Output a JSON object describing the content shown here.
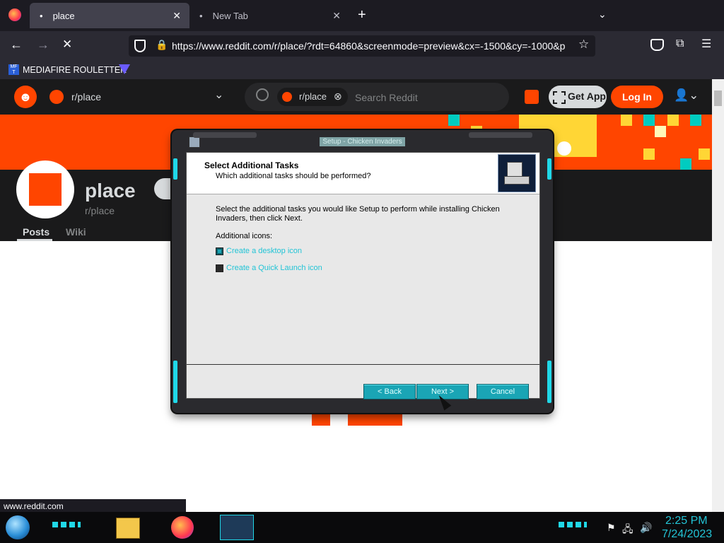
{
  "browser": {
    "tabs": [
      {
        "label": "place",
        "active": true
      },
      {
        "label": "New Tab",
        "active": false
      }
    ],
    "url": "https://www.reddit.com/r/place/?rdt=64860&screenmode=preview&cx=-1500&cy=-1000&p",
    "bookmarks": [
      {
        "label": "MEDIAFIRE ROULETTER",
        "icon": "mf-icon"
      },
      {
        "label": "",
        "icon": "triangle-icon"
      }
    ],
    "status_url": "www.reddit.com"
  },
  "reddit": {
    "community_short": "r/place",
    "search_chip": "r/place",
    "search_placeholder": "Search Reddit",
    "get_app": "Get App",
    "login": "Log In",
    "community_name": "place",
    "community_sub": "r/place",
    "tabs": [
      "Posts",
      "Wiki"
    ]
  },
  "dialog": {
    "title": "Setup - Chicken Invaders",
    "heading": "Select Additional Tasks",
    "subheading": "Which additional tasks should be performed?",
    "description": "Select the additional tasks you would like Setup to perform while installing Chicken Invaders, then click Next.",
    "group_label": "Additional icons:",
    "options": [
      {
        "label": "Create a desktop icon",
        "checked": true
      },
      {
        "label": "Create a Quick Launch icon",
        "checked": false
      }
    ],
    "buttons": {
      "back": "< Back",
      "next": "Next >",
      "cancel": "Cancel"
    }
  },
  "taskbar": {
    "time": "2:25 PM",
    "date": "7/24/2023"
  },
  "colors": {
    "accent": "#ff4500",
    "dialog_button": "#1aa5b5",
    "link_cyan": "#22c4d6"
  }
}
